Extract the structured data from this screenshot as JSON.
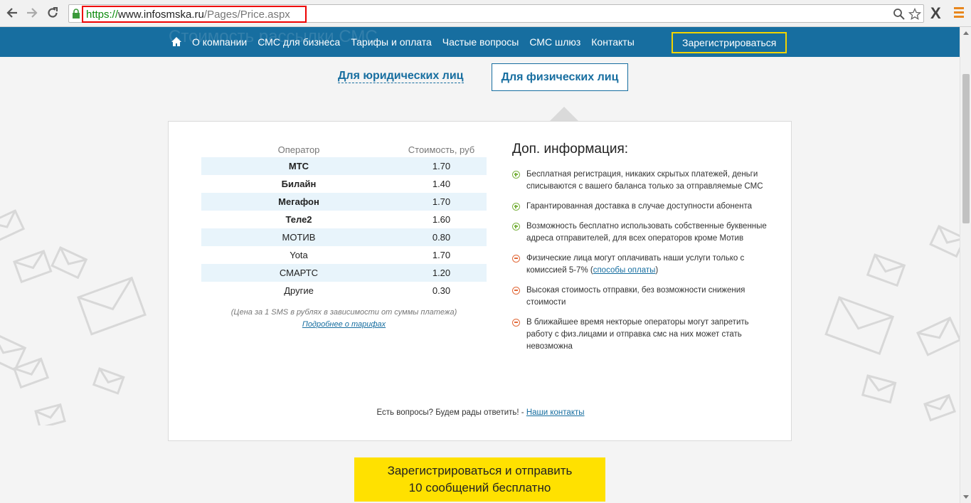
{
  "browser": {
    "url_scheme": "https://",
    "url_host": "www.infosmska.ru",
    "url_path": "/Pages/Price.aspx",
    "icons": [
      "back-icon",
      "forward-icon",
      "reload-icon",
      "lock-icon",
      "zoom-icon",
      "star-icon",
      "extension-x-icon",
      "menu-icon"
    ]
  },
  "nav": {
    "ghost_title": "Стоимость рассылки СМС",
    "items": [
      "О компании",
      "СМС для бизнеса",
      "Тарифы и оплата",
      "Частые вопросы",
      "СМС шлюз",
      "Контакты"
    ],
    "register": "Зарегистрироваться"
  },
  "tabs": {
    "legal": "Для юридических лиц",
    "physical": "Для физических лиц"
  },
  "prices": {
    "header_operator": "Оператор",
    "header_cost": "Стоимость, руб",
    "rows": [
      {
        "operator": "МТС",
        "cost": "1.70"
      },
      {
        "operator": "Билайн",
        "cost": "1.40"
      },
      {
        "operator": "Мегафон",
        "cost": "1.70"
      },
      {
        "operator": "Теле2",
        "cost": "1.60"
      },
      {
        "operator": "МОТИВ",
        "cost": "0.80"
      },
      {
        "operator": "Yota",
        "cost": "1.70"
      },
      {
        "operator": "СМАРТС",
        "cost": "1.20"
      },
      {
        "operator": "Другие",
        "cost": "0.30"
      }
    ],
    "note": "(Цена за 1 SMS в рублях в зависимости от суммы платежа)",
    "more_link": "Подробнее о тарифах"
  },
  "info": {
    "title": "Доп. информация:",
    "items": [
      {
        "type": "plus",
        "text": "Бесплатная регистрация, никаких скрытых платежей, деньги списываются с вашего баланса только за отправляемые СМС"
      },
      {
        "type": "plus",
        "text": "Гарантированная доставка в случае доступности абонента"
      },
      {
        "type": "plus",
        "text": "Возможность бесплатно использовать собственные буквенные адреса отправителей, для всех операторов кроме Мотив"
      },
      {
        "type": "minus",
        "text": "Физические лица могут оплачивать наши услуги только с комиссией 5-7% (",
        "link": "способы оплаты",
        "after": ")"
      },
      {
        "type": "minus",
        "text": "Высокая стоимость отправки, без возможности снижения стоимости"
      },
      {
        "type": "minus",
        "text": "В ближайшее время некторые операторы могут запретить работу с физ.лицами и отправка смс на них может стать невозможна"
      }
    ]
  },
  "questions": {
    "text": "Есть вопросы? Будем рады ответить! - ",
    "link": "Наши контакты"
  },
  "cta": {
    "line1": "Зарегистрироваться и отправить",
    "line2": "10 сообщений бесплатно"
  },
  "colors": {
    "nav_bg": "#176ea0",
    "register_border": "#f2d400",
    "cta_bg": "#ffe100",
    "row_shade": "#e8f4fb",
    "plus": "#7cb342",
    "minus": "#e26a3a"
  }
}
